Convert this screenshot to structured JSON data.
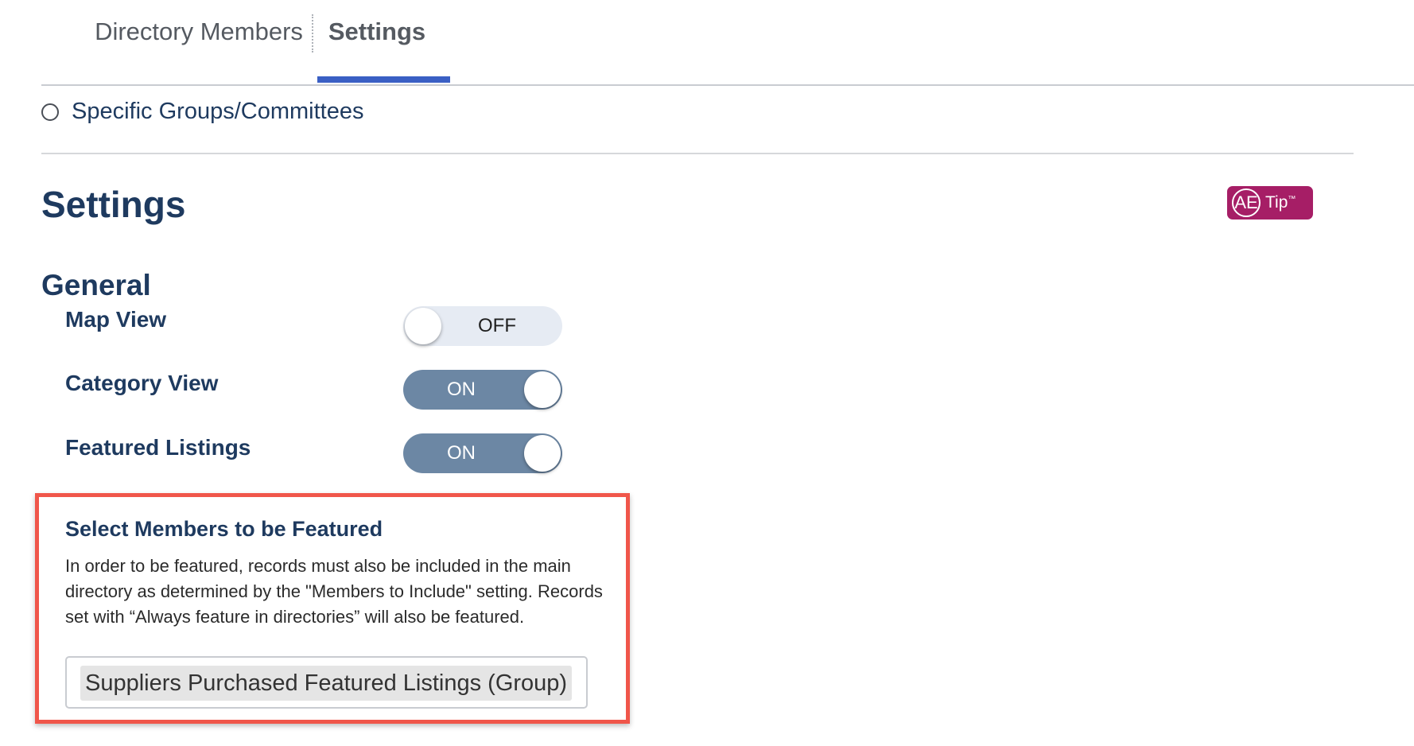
{
  "tabs": [
    {
      "label": "Directory Members",
      "active": false
    },
    {
      "label": "Settings",
      "active": true
    }
  ],
  "radio_option": {
    "label": "Specific Groups/Committees",
    "selected": false
  },
  "section_title": "Settings",
  "ae_tip": {
    "ae": "AE",
    "label": "Tip",
    "tm": "™"
  },
  "general": {
    "title": "General",
    "settings": [
      {
        "label": "Map View",
        "state": "OFF"
      },
      {
        "label": "Category View",
        "state": "ON"
      },
      {
        "label": "Featured Listings",
        "state": "ON"
      }
    ]
  },
  "featured": {
    "title": "Select Members to be Featured",
    "description": "In order to be featured, records must also be included in the main directory as determined by the \"Members to Include\" setting. Records set with “Always feature in directories” will also be featured.",
    "selected_item": "Suppliers Purchased Featured Listings (Group)"
  },
  "colors": {
    "accent_tab": "#3a5fc4",
    "heading_text": "#1e3a5f",
    "toggle_on": "#6c87a4",
    "toggle_off": "#e6ebf3",
    "highlight_border": "#f0564a",
    "ae_tip_bg": "#a61e66"
  }
}
